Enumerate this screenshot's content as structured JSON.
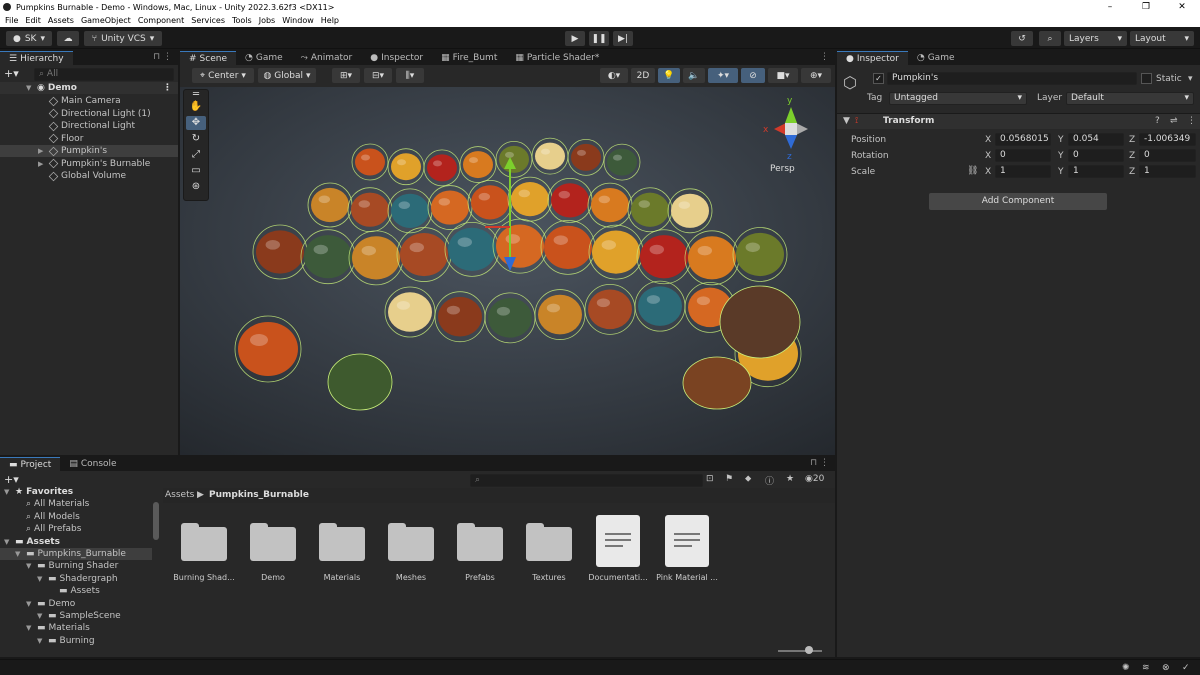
{
  "window": {
    "title": "Pumpkins Burnable - Demo - Windows, Mac, Linux - Unity 2022.3.62f3 <DX11>",
    "controls": [
      "–",
      "❐",
      "✕"
    ]
  },
  "menu": [
    "File",
    "Edit",
    "Assets",
    "GameObject",
    "Component",
    "Services",
    "Tools",
    "Jobs",
    "Window",
    "Help"
  ],
  "toolbar": {
    "account": "SK",
    "vcs": "Unity VCS",
    "layers": "Layers",
    "layout": "Layout"
  },
  "hierarchy": {
    "tab": "Hierarchy",
    "search_placeholder": "All",
    "scene": "Demo",
    "items": [
      {
        "label": "Main Camera",
        "expand": ""
      },
      {
        "label": "Directional Light (1)",
        "expand": ""
      },
      {
        "label": "Directional Light",
        "expand": ""
      },
      {
        "label": "Floor",
        "expand": ""
      },
      {
        "label": "Pumpkin's",
        "expand": "▶"
      },
      {
        "label": "Pumpkin's Burnable",
        "expand": "▶"
      },
      {
        "label": "Global Volume",
        "expand": ""
      }
    ]
  },
  "center_tabs": [
    "Scene",
    "Game",
    "Animator",
    "Inspector",
    "Fire_Bumt",
    "Particle Shader*"
  ],
  "scene_toolbar": {
    "pivot": "Center",
    "space": "Global",
    "mode2d": "2D",
    "persp": "Persp",
    "gizmo_x": "x",
    "gizmo_y": "y",
    "gizmo_z": "z"
  },
  "inspector": {
    "tabs": [
      "Inspector",
      "Game"
    ],
    "object_name": "Pumpkin's",
    "static_label": "Static",
    "tag_label": "Tag",
    "tag_value": "Untagged",
    "layer_label": "Layer",
    "layer_value": "Default",
    "component": "Transform",
    "rows": [
      {
        "label": "Position",
        "x": "0.0568015",
        "y": "0.054",
        "z": "-1.006349"
      },
      {
        "label": "Rotation",
        "x": "0",
        "y": "0",
        "z": "0"
      },
      {
        "label": "Scale",
        "x": "1",
        "y": "1",
        "z": "1"
      }
    ],
    "axis": [
      "X",
      "Y",
      "Z"
    ],
    "add_component": "Add Component"
  },
  "project": {
    "tabs": [
      "Project",
      "Console"
    ],
    "count": "20",
    "breadcrumb": [
      "Assets",
      "Pumpkins_Burnable"
    ],
    "tree": [
      {
        "label": "Favorites",
        "level": 0,
        "kind": "star",
        "bold": true
      },
      {
        "label": "All Materials",
        "level": 1,
        "kind": "search"
      },
      {
        "label": "All Models",
        "level": 1,
        "kind": "search"
      },
      {
        "label": "All Prefabs",
        "level": 1,
        "kind": "search"
      },
      {
        "label": "Assets",
        "level": 0,
        "kind": "folder",
        "bold": true
      },
      {
        "label": "Pumpkins_Burnable",
        "level": 1,
        "kind": "folder",
        "selected": true
      },
      {
        "label": "Burning Shader",
        "level": 2,
        "kind": "folder"
      },
      {
        "label": "Shadergraph",
        "level": 3,
        "kind": "folder"
      },
      {
        "label": "Assets",
        "level": 4,
        "kind": "folder"
      },
      {
        "label": "Demo",
        "level": 2,
        "kind": "folder"
      },
      {
        "label": "SampleScene",
        "level": 3,
        "kind": "folder"
      },
      {
        "label": "Materials",
        "level": 2,
        "kind": "folder"
      },
      {
        "label": "Burning",
        "level": 3,
        "kind": "folder"
      }
    ],
    "assets": [
      {
        "label": "Burning Shad...",
        "type": "folder"
      },
      {
        "label": "Demo",
        "type": "folder"
      },
      {
        "label": "Materials",
        "type": "folder"
      },
      {
        "label": "Meshes",
        "type": "folder"
      },
      {
        "label": "Prefabs",
        "type": "folder"
      },
      {
        "label": "Textures",
        "type": "folder"
      },
      {
        "label": "Documentati...",
        "type": "doc"
      },
      {
        "label": "Pink Material ...",
        "type": "doc"
      }
    ]
  },
  "colors": {
    "accent": "#3a79bb",
    "panel": "#282828",
    "dark": "#191919",
    "gizmo_x": "#d23a2a",
    "gizmo_y": "#7ccf2c",
    "gizmo_z": "#2f6bd6"
  }
}
